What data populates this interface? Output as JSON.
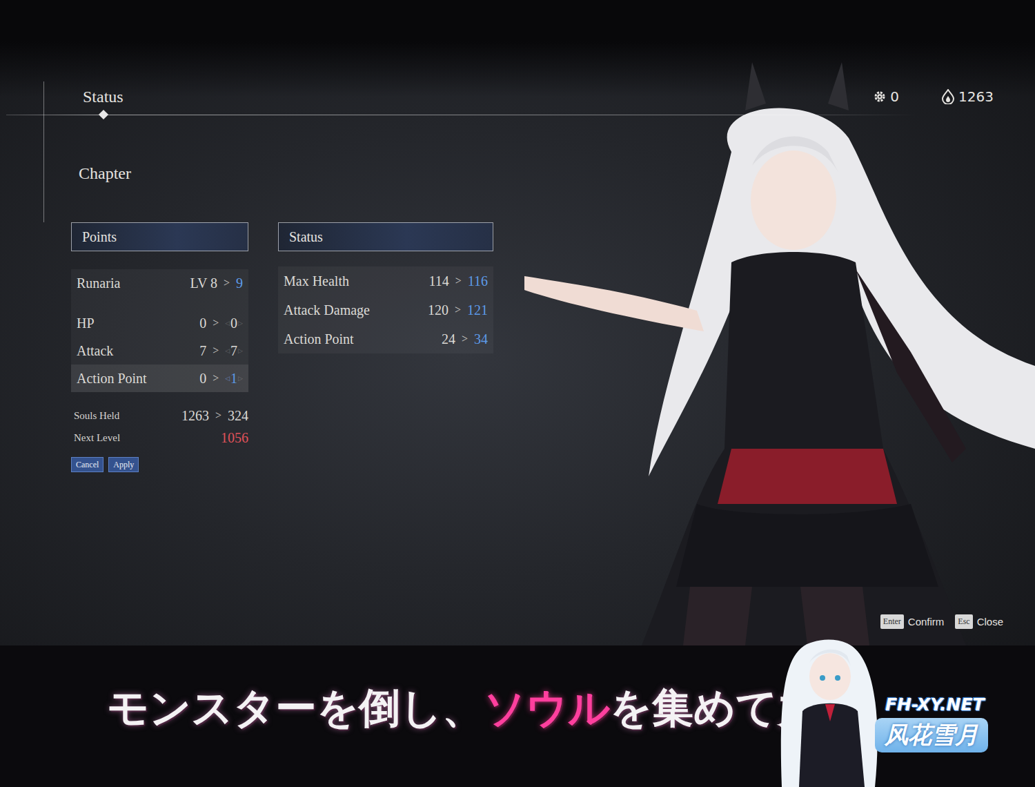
{
  "header": {
    "title": "Status",
    "currency": [
      {
        "kind": "gear",
        "value": "0"
      },
      {
        "kind": "soul",
        "value": "1263"
      }
    ]
  },
  "chapter": "Chapter",
  "points": {
    "title": "Points",
    "character": {
      "name": "Runaria",
      "current": "LV 8",
      "arrow": ">",
      "next": "9",
      "changed": true
    },
    "rows": [
      {
        "label": "HP",
        "current": "0",
        "arrow": ">",
        "next": "0",
        "decrement": "◁",
        "increment": "▷",
        "changed": false,
        "selected": false
      },
      {
        "label": "Attack",
        "current": "7",
        "arrow": ">",
        "next": "7",
        "decrement": "◁",
        "increment": "▷",
        "changed": false,
        "selected": false
      },
      {
        "label": "Action Point",
        "current": "0",
        "arrow": ">",
        "next": "1",
        "decrement": "◁",
        "increment": "▷",
        "changed": true,
        "selected": true
      }
    ],
    "souls": {
      "label": "Souls Held",
      "current": "1263",
      "arrow": ">",
      "next": "324"
    },
    "next_level": {
      "label": "Next Level",
      "value": "1056"
    },
    "buttons": [
      "Cancel",
      "Apply"
    ]
  },
  "status": {
    "title": "Status",
    "rows": [
      {
        "label": "Max Health",
        "current": "114",
        "arrow": ">",
        "next": "116"
      },
      {
        "label": "Attack Damage",
        "current": "120",
        "arrow": ">",
        "next": "121"
      },
      {
        "label": "Action Point",
        "current": "24",
        "arrow": ">",
        "next": "34"
      }
    ]
  },
  "hints": [
    {
      "key": "Enter",
      "label": "Confirm"
    },
    {
      "key": "Esc",
      "label": "Close"
    }
  ],
  "subtitle": [
    {
      "text": "モンスターを倒し、",
      "highlight": false
    },
    {
      "text": "ソウル",
      "highlight": true
    },
    {
      "text": "を集めて力",
      "highlight": false
    }
  ],
  "watermark": {
    "url": "FH-XY.NET",
    "name": "风花雪月"
  }
}
